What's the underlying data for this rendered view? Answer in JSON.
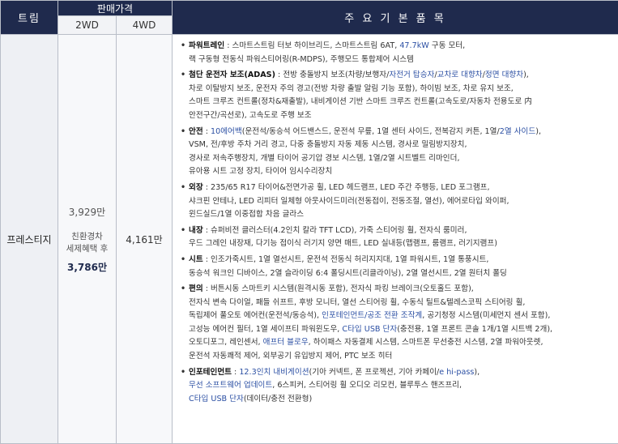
{
  "header": {
    "trim": "트림",
    "price": "판매가격",
    "wd2": "2WD",
    "wd4": "4WD",
    "items": "주 요 기 본 품 목"
  },
  "row": {
    "trim": "프레스티지",
    "price_2wd": "3,929만",
    "eco_label_1": "친환경차",
    "eco_label_2": "세제혜택 후",
    "eco_price": "3,786만",
    "price_4wd": "4,161만"
  },
  "groups": [
    {
      "title": "파워트레인",
      "segments": [
        {
          "t": " : 스마트스트림 터보 하이브리드, 스마트스트림 6AT, ",
          "hl": false
        },
        {
          "t": "47.7kW",
          "hl": true
        },
        {
          "t": " 구동 모터,",
          "hl": false
        },
        {
          "t": "랙 구동형 전동식 파워스티어링(R-MDPS), 주행모드 통합제어 시스템",
          "hl": false,
          "br": true
        }
      ]
    },
    {
      "title": "첨단 운전자 보조(ADAS)",
      "segments": [
        {
          "t": " : 전방 충돌방지 보조(차량/보행자/",
          "hl": false
        },
        {
          "t": "자전거 탑승자",
          "hl": true
        },
        {
          "t": "/",
          "hl": false
        },
        {
          "t": "교차로 대향차",
          "hl": true
        },
        {
          "t": "/",
          "hl": false
        },
        {
          "t": "정면 대향차",
          "hl": true
        },
        {
          "t": "),",
          "hl": false
        },
        {
          "t": "차로 이탈방지 보조, 운전자 주의 경고(전방 차량 출발 알림 기능 포함), 하이빔 보조, 차로 유지 보조,",
          "hl": false,
          "br": true
        },
        {
          "t": "스마트 크루즈 컨트롤(정차&재출발), 내비게이션 기반 스마트 크루즈 컨트롤(고속도로/자동차 전용도로 内",
          "hl": false,
          "br": true
        },
        {
          "t": "안전구간/곡선로), 고속도로 주행 보조",
          "hl": false,
          "br": true
        }
      ]
    },
    {
      "title": "안전",
      "segments": [
        {
          "t": " : ",
          "hl": false
        },
        {
          "t": "10에어백",
          "hl": true
        },
        {
          "t": "(운전석/동승석 어드밴스드, 운전석 무릎, 1열 센터 사이드, 전복감지 커튼, 1열/",
          "hl": false
        },
        {
          "t": "2열 사이드",
          "hl": true
        },
        {
          "t": "),",
          "hl": false
        },
        {
          "t": "VSM, 전/후방 주차 거리 경고, 다중 충돌방지 자동 제동 시스템, 경사로 밀림방지장치,",
          "hl": false,
          "br": true
        },
        {
          "t": "경사로 저속주행장치, 개별 타이어 공기압 경보 시스템, 1열/2열 시트벨트 리마인더,",
          "hl": false,
          "br": true
        },
        {
          "t": "유아용 시트 고정 장치, 타이어 임시수리장치",
          "hl": false,
          "br": true
        }
      ]
    },
    {
      "title": "외장",
      "segments": [
        {
          "t": " : 235/65 R17 타이어&전면가공 휠, LED 헤드램프, LED 주간 주행등, LED 포그램프,",
          "hl": false
        },
        {
          "t": "샤크핀 안테나, LED 리피터 일체형 아웃사이드미러(전동접이, 전동조절, 열선), 에어로타입 와이퍼,",
          "hl": false,
          "br": true
        },
        {
          "t": "윈드실드/1열 이중접합 차음 글라스",
          "hl": false,
          "br": true
        }
      ]
    },
    {
      "title": "내장",
      "segments": [
        {
          "t": " : 슈퍼비전 클러스터(4.2인치 칼라 TFT LCD), 가죽 스티어링 휠, 전자식 룸미러,",
          "hl": false
        },
        {
          "t": "우드 그레인 내장재, 다기능 접이식 러기지 양면 매트, LED 실내등(맵램프, 룸램프, 러기지램프)",
          "hl": false,
          "br": true
        }
      ]
    },
    {
      "title": "시트",
      "segments": [
        {
          "t": " : 인조가죽시트, 1열 열선시트, 운전석 전동식 허리지지대, 1열 파워시트, 1열 통풍시트,",
          "hl": false
        },
        {
          "t": "동승석 워크인 디바이스, 2열 슬라이딩 6:4 폴딩시트(리클라이닝), 2열 열선시트, 2열 원터치 폴딩",
          "hl": false,
          "br": true
        }
      ]
    },
    {
      "title": "편의",
      "segments": [
        {
          "t": " : 버튼시동 스마트키 시스템(원격시동 포함), 전자식 파킹 브레이크(오토홀드 포함),",
          "hl": false
        },
        {
          "t": "전자식 변속 다이얼, 패들 쉬프트, 후방 모니터, 열선 스티어링 휠, 수동식 틸트&텔레스코픽 스티어링 휠,",
          "hl": false,
          "br": true
        },
        {
          "t": "독립제어 풀오토 에어컨(운전석/동승석), ",
          "hl": false,
          "br": true
        },
        {
          "t": "인포테인먼트/공조 전환 조작계",
          "hl": true
        },
        {
          "t": ", 공기청정 시스템(미세먼지 센서 포함),",
          "hl": false
        },
        {
          "t": "고성능 에어컨 필터, 1열 세이프티 파워윈도우, ",
          "hl": false,
          "br": true
        },
        {
          "t": "C타입 USB 단자",
          "hl": true
        },
        {
          "t": "(충전용, 1열 프론트 콘솔 1개/1열 시트백 2개),",
          "hl": false
        },
        {
          "t": "오토디포그, 레인센서, ",
          "hl": false,
          "br": true
        },
        {
          "t": "애프터 블로우",
          "hl": true
        },
        {
          "t": ", 하이패스 자동결제 시스템, 스마트폰 무선충전 시스템, 2열 파워아웃렛,",
          "hl": false
        },
        {
          "t": "운전석 자동쾌적 제어, 외부공기 유입방지 제어, PTC 보조 히터",
          "hl": false,
          "br": true
        }
      ]
    },
    {
      "title": "인포테인먼트",
      "segments": [
        {
          "t": " : ",
          "hl": false
        },
        {
          "t": "12.3인치 내비게이션",
          "hl": true
        },
        {
          "t": "(기아 커넥트, 폰 프로젝션, 기아 카페이/",
          "hl": false
        },
        {
          "t": "e hi-pass",
          "hl": true
        },
        {
          "t": "),",
          "hl": false
        },
        {
          "t": "무선 소프트웨어 업데이트",
          "hl": true,
          "br": true
        },
        {
          "t": ", 6스피커, 스티어링 휠 오디오 리모컨, 블루투스 핸즈프리,",
          "hl": false
        },
        {
          "t": "C타입 USB 단자",
          "hl": true,
          "br": true
        },
        {
          "t": "(데이터/충전 전환형)",
          "hl": false
        }
      ]
    }
  ],
  "bullet": "•",
  "colors": {
    "header_bg": "#1f2a4d",
    "highlight": "#2b4fa3",
    "border": "#b9bec8"
  }
}
